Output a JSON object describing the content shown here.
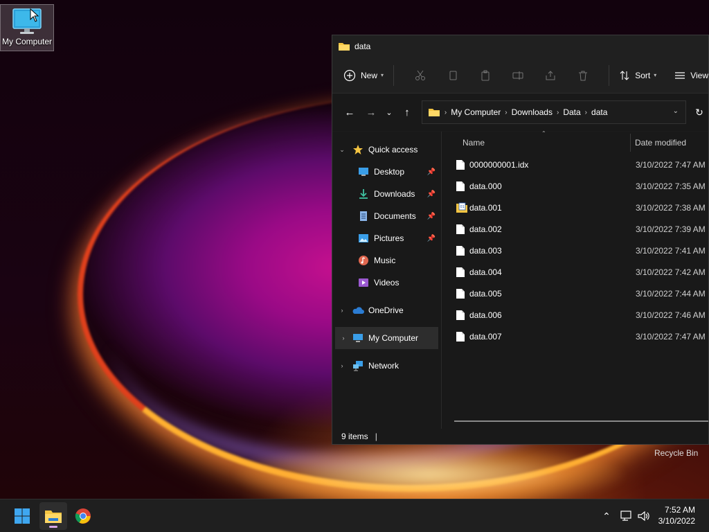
{
  "desktop": {
    "icon_label": "My Computer",
    "recycle_bin_label": "Recycle Bin"
  },
  "window": {
    "title": "data",
    "toolbar": {
      "new_label": "New",
      "sort_label": "Sort",
      "view_label": "View"
    },
    "address": {
      "crumbs": [
        "My Computer",
        "Downloads",
        "Data",
        "data"
      ]
    },
    "nav": {
      "quick_access": "Quick access",
      "items": [
        {
          "label": "Desktop",
          "pinned": true
        },
        {
          "label": "Downloads",
          "pinned": true
        },
        {
          "label": "Documents",
          "pinned": true
        },
        {
          "label": "Pictures",
          "pinned": true
        },
        {
          "label": "Music",
          "pinned": false
        },
        {
          "label": "Videos",
          "pinned": false
        }
      ],
      "onedrive": "OneDrive",
      "my_computer": "My Computer",
      "network": "Network"
    },
    "columns": {
      "name": "Name",
      "date_modified": "Date modified"
    },
    "files": [
      {
        "name": "0000000001.idx",
        "date": "3/10/2022 7:47 AM"
      },
      {
        "name": "data.000",
        "date": "3/10/2022 7:35 AM"
      },
      {
        "name": "data.001",
        "date": "3/10/2022 7:38 AM"
      },
      {
        "name": "data.002",
        "date": "3/10/2022 7:39 AM"
      },
      {
        "name": "data.003",
        "date": "3/10/2022 7:41 AM"
      },
      {
        "name": "data.004",
        "date": "3/10/2022 7:42 AM"
      },
      {
        "name": "data.005",
        "date": "3/10/2022 7:44 AM"
      },
      {
        "name": "data.006",
        "date": "3/10/2022 7:46 AM"
      },
      {
        "name": "data.007",
        "date": "3/10/2022 7:47 AM"
      }
    ],
    "status": "9 items"
  },
  "taskbar": {
    "time": "7:52 AM",
    "date": "3/10/2022"
  },
  "colors": {
    "window_bg": "#1c1c1c",
    "taskbar_bg": "#1f1f1f",
    "folder_yellow": "#f5c542",
    "accent_blue": "#3a9ee8"
  }
}
